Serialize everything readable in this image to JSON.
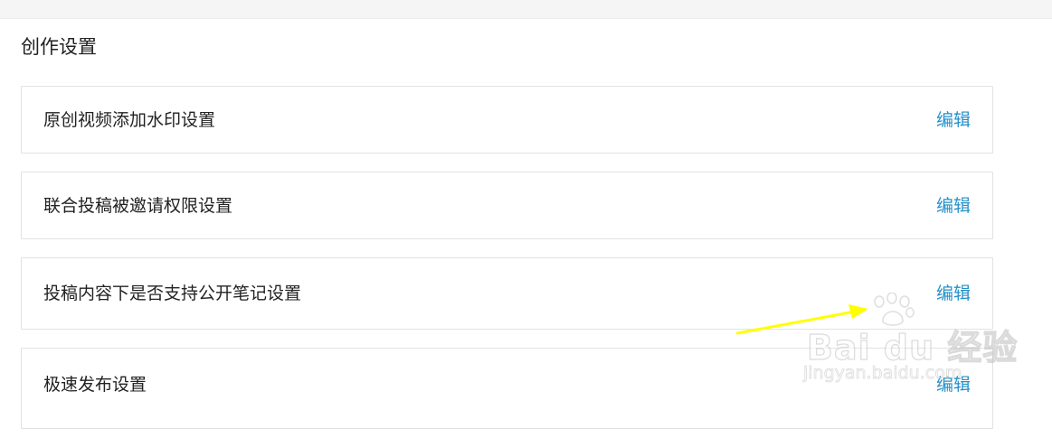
{
  "section": {
    "title": "创作设置"
  },
  "settings": [
    {
      "label": "原创视频添加水印设置",
      "action": "编辑"
    },
    {
      "label": "联合投稿被邀请权限设置",
      "action": "编辑"
    },
    {
      "label": "投稿内容下是否支持公开笔记设置",
      "action": "编辑"
    },
    {
      "label": "极速发布设置",
      "action": "编辑"
    }
  ],
  "watermark": {
    "brand": "Bai du 经验",
    "url": "jingyan.baidu.com"
  },
  "colors": {
    "link": "#2590c9",
    "text": "#222222",
    "border": "#e2e2e2",
    "annotation_arrow": "#ffff00"
  },
  "icons": {
    "annotation": "yellow-arrow",
    "watermark_logo": "paw-icon"
  }
}
